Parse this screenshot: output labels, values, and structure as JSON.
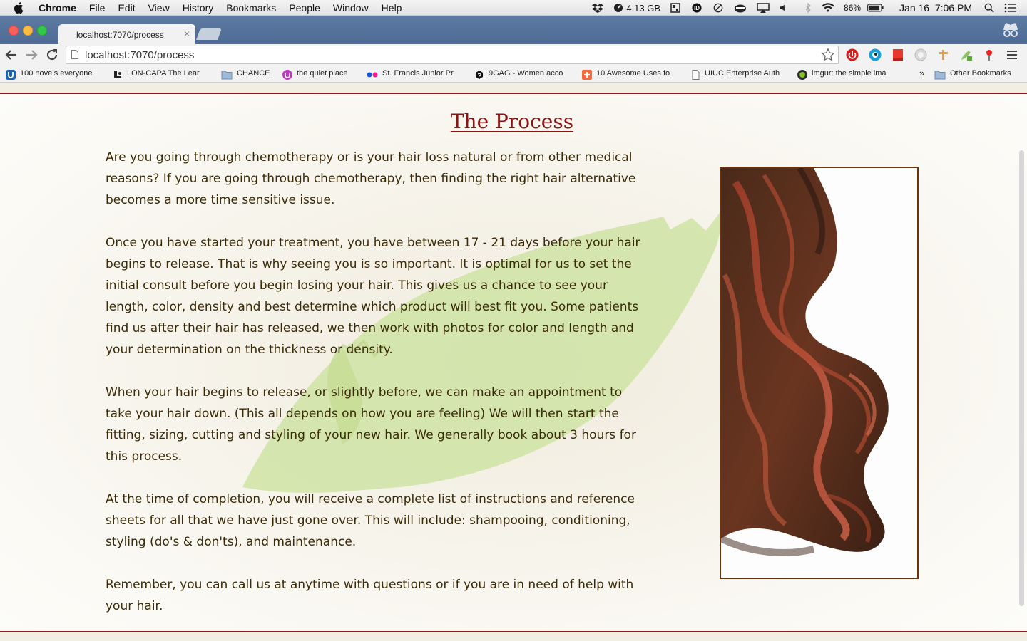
{
  "menubar": {
    "app_name": "Chrome",
    "menus": [
      "File",
      "Edit",
      "View",
      "History",
      "Bookmarks",
      "People",
      "Window",
      "Help"
    ],
    "memory": "4.13 GB",
    "battery": "86%",
    "clock": "Jan 16  7:06 PM"
  },
  "tab": {
    "title": "localhost:7070/process",
    "close": "×"
  },
  "toolbar": {
    "url": "localhost:7070/process"
  },
  "bookmarks": {
    "items": [
      {
        "label": "100 novels everyone",
        "icon": "u-icon"
      },
      {
        "label": "LON-CAPA The Lear",
        "icon": "loncapa-icon"
      },
      {
        "label": "CHANCE",
        "icon": "folder-icon"
      },
      {
        "label": "the quiet place",
        "icon": "quiet-place-icon"
      },
      {
        "label": "St. Francis Junior Pr",
        "icon": "flickr-dots-icon"
      },
      {
        "label": "9GAG - Women acco",
        "icon": "9gag-icon"
      },
      {
        "label": "10 Awesome Uses fo",
        "icon": "plus-cross-icon"
      },
      {
        "label": "UIUC Enterprise Auth",
        "icon": "page-icon"
      },
      {
        "label": "imgur: the simple ima",
        "icon": "imgur-icon"
      }
    ],
    "overflow": "»",
    "other": "Other Bookmarks"
  },
  "page": {
    "heading": "The Process",
    "paragraphs": [
      "Are you going through chemotherapy or is your hair loss natural or from other medical reasons? If you are going through chemotherapy, then finding the right hair alternative becomes a more time sensitive issue.",
      "Once you have started your treatment, you have between 17 - 21 days before your hair begins to release. That is why seeing you is so important. It is optimal for us to set the initial consult before you begin losing your hair. This gives us a chance to see your length, color, density and best determine which product will best fit you. Some patients find us after their hair has released, we then work with photos for color and length and your determination on the thickness or density.",
      "When your hair begins to release, or slightly before, we can make an appointment to take your hair down. (This all depends on how you are feeling) We will then start the fitting, sizing, cutting and styling of your new hair. We generally book about 3 hours for this process.",
      "At the time of completion, you will receive a complete list of instructions and reference sheets for all that we have just gone over. This will include: shampooing, conditioning, styling (do's & don'ts), and maintenance.",
      "Remember, you can call us at anytime with questions or if you are in need of help with your hair."
    ]
  },
  "colors": {
    "heading": "#8b1515",
    "body_text": "#3a2a06",
    "rule": "#8c1c1c",
    "photo_border": "#6b3410",
    "leaf": "#cfe3a4"
  }
}
